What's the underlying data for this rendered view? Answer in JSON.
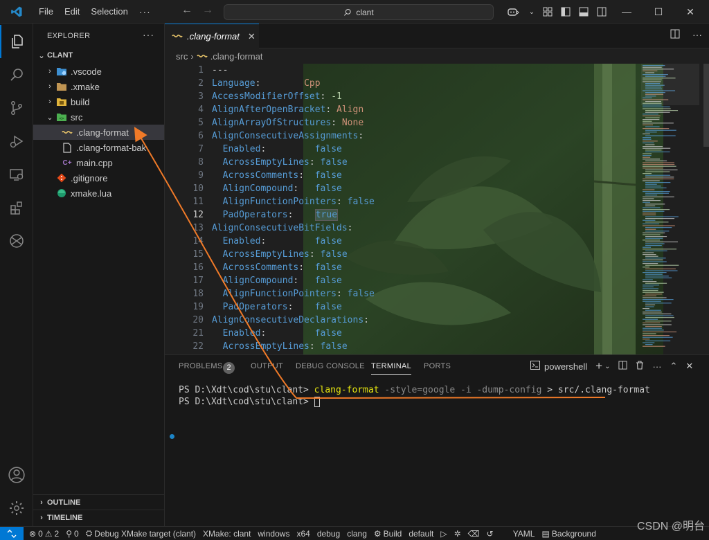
{
  "titlebar": {
    "menus": [
      "File",
      "Edit",
      "Selection"
    ],
    "more": "···",
    "search_text": "clant",
    "win_min": "—",
    "win_max": "☐",
    "win_close": "✕"
  },
  "sidebar": {
    "title": "EXPLORER",
    "more": "···",
    "root": "CLANT",
    "items": [
      {
        "label": ".vscode",
        "icon": "vscode-folder-icon"
      },
      {
        "label": ".xmake",
        "icon": "folder-icon"
      },
      {
        "label": "build",
        "icon": "folder-icon"
      },
      {
        "label": "src",
        "icon": "src-folder-icon"
      },
      {
        "label": ".clang-format",
        "icon": "clang-format-icon"
      },
      {
        "label": ".clang-format-bak",
        "icon": "file-icon"
      },
      {
        "label": "main.cpp",
        "icon": "cpp-icon"
      },
      {
        "label": ".gitignore",
        "icon": "git-icon"
      },
      {
        "label": "xmake.lua",
        "icon": "lua-icon"
      }
    ],
    "outline": "OUTLINE",
    "timeline": "TIMELINE"
  },
  "editor": {
    "tab_label": ".clang-format",
    "breadcrumb_folder": "src",
    "breadcrumb_file": ".clang-format",
    "current_line": 12,
    "lines": [
      {
        "n": "1",
        "key": "---",
        "sep": "",
        "val": ""
      },
      {
        "n": "2",
        "key": "Language",
        "sep": ":        ",
        "val": "Cpp"
      },
      {
        "n": "3",
        "key": "AccessModifierOffset",
        "sep": ": ",
        "val": "-1"
      },
      {
        "n": "4",
        "key": "AlignAfterOpenBracket",
        "sep": ": ",
        "val": "Align"
      },
      {
        "n": "5",
        "key": "AlignArrayOfStructures",
        "sep": ": ",
        "val": "None"
      },
      {
        "n": "6",
        "key": "AlignConsecutiveAssignments",
        "sep": ":",
        "val": ""
      },
      {
        "n": "7",
        "key": "  Enabled",
        "sep": ":         ",
        "val": "false"
      },
      {
        "n": "8",
        "key": "  AcrossEmptyLines",
        "sep": ": ",
        "val": "false"
      },
      {
        "n": "9",
        "key": "  AcrossComments",
        "sep": ":  ",
        "val": "false"
      },
      {
        "n": "10",
        "key": "  AlignCompound",
        "sep": ":   ",
        "val": "false"
      },
      {
        "n": "11",
        "key": "  AlignFunctionPointers",
        "sep": ": ",
        "val": "false"
      },
      {
        "n": "12",
        "key": "  PadOperators",
        "sep": ":    ",
        "val": "true"
      },
      {
        "n": "13",
        "key": "AlignConsecutiveBitFields",
        "sep": ":",
        "val": ""
      },
      {
        "n": "14",
        "key": "  Enabled",
        "sep": ":         ",
        "val": "false"
      },
      {
        "n": "15",
        "key": "  AcrossEmptyLines",
        "sep": ": ",
        "val": "false"
      },
      {
        "n": "16",
        "key": "  AcrossComments",
        "sep": ":  ",
        "val": "false"
      },
      {
        "n": "17",
        "key": "  AlignCompound",
        "sep": ":   ",
        "val": "false"
      },
      {
        "n": "18",
        "key": "  AlignFunctionPointers",
        "sep": ": ",
        "val": "false"
      },
      {
        "n": "19",
        "key": "  PadOperators",
        "sep": ":    ",
        "val": "false"
      },
      {
        "n": "20",
        "key": "AlignConsecutiveDeclarations",
        "sep": ":",
        "val": ""
      },
      {
        "n": "21",
        "key": "  Enabled",
        "sep": ":         ",
        "val": "false"
      },
      {
        "n": "22",
        "key": "  AcrossEmptyLines",
        "sep": ": ",
        "val": "false"
      }
    ]
  },
  "panel": {
    "tabs": [
      "PROBLEMS",
      "OUTPUT",
      "DEBUG CONSOLE",
      "TERMINAL",
      "PORTS"
    ],
    "problems_count": "2",
    "active_tab": "TERMINAL",
    "shell": "powershell",
    "prompt": "PS D:\\Xdt\\cod\\stu\\clant>",
    "command": "clang-format",
    "args": "-style=google -i -dump-config",
    "redirect": ">",
    "target": "src/.clang-format"
  },
  "statusbar": {
    "errors": "0",
    "warnings": "2",
    "ports": "0",
    "debug_target": "Debug XMake target (clant)",
    "xmake": "XMake: clant",
    "items": [
      "windows",
      "x64",
      "debug",
      "clang"
    ],
    "build": "Build",
    "build_target": "default",
    "language": "YAML",
    "background": "Background",
    "watermark": "CSDN @明台"
  },
  "colors": {
    "accent": "#0078d4",
    "annotation": "#f07a28"
  }
}
